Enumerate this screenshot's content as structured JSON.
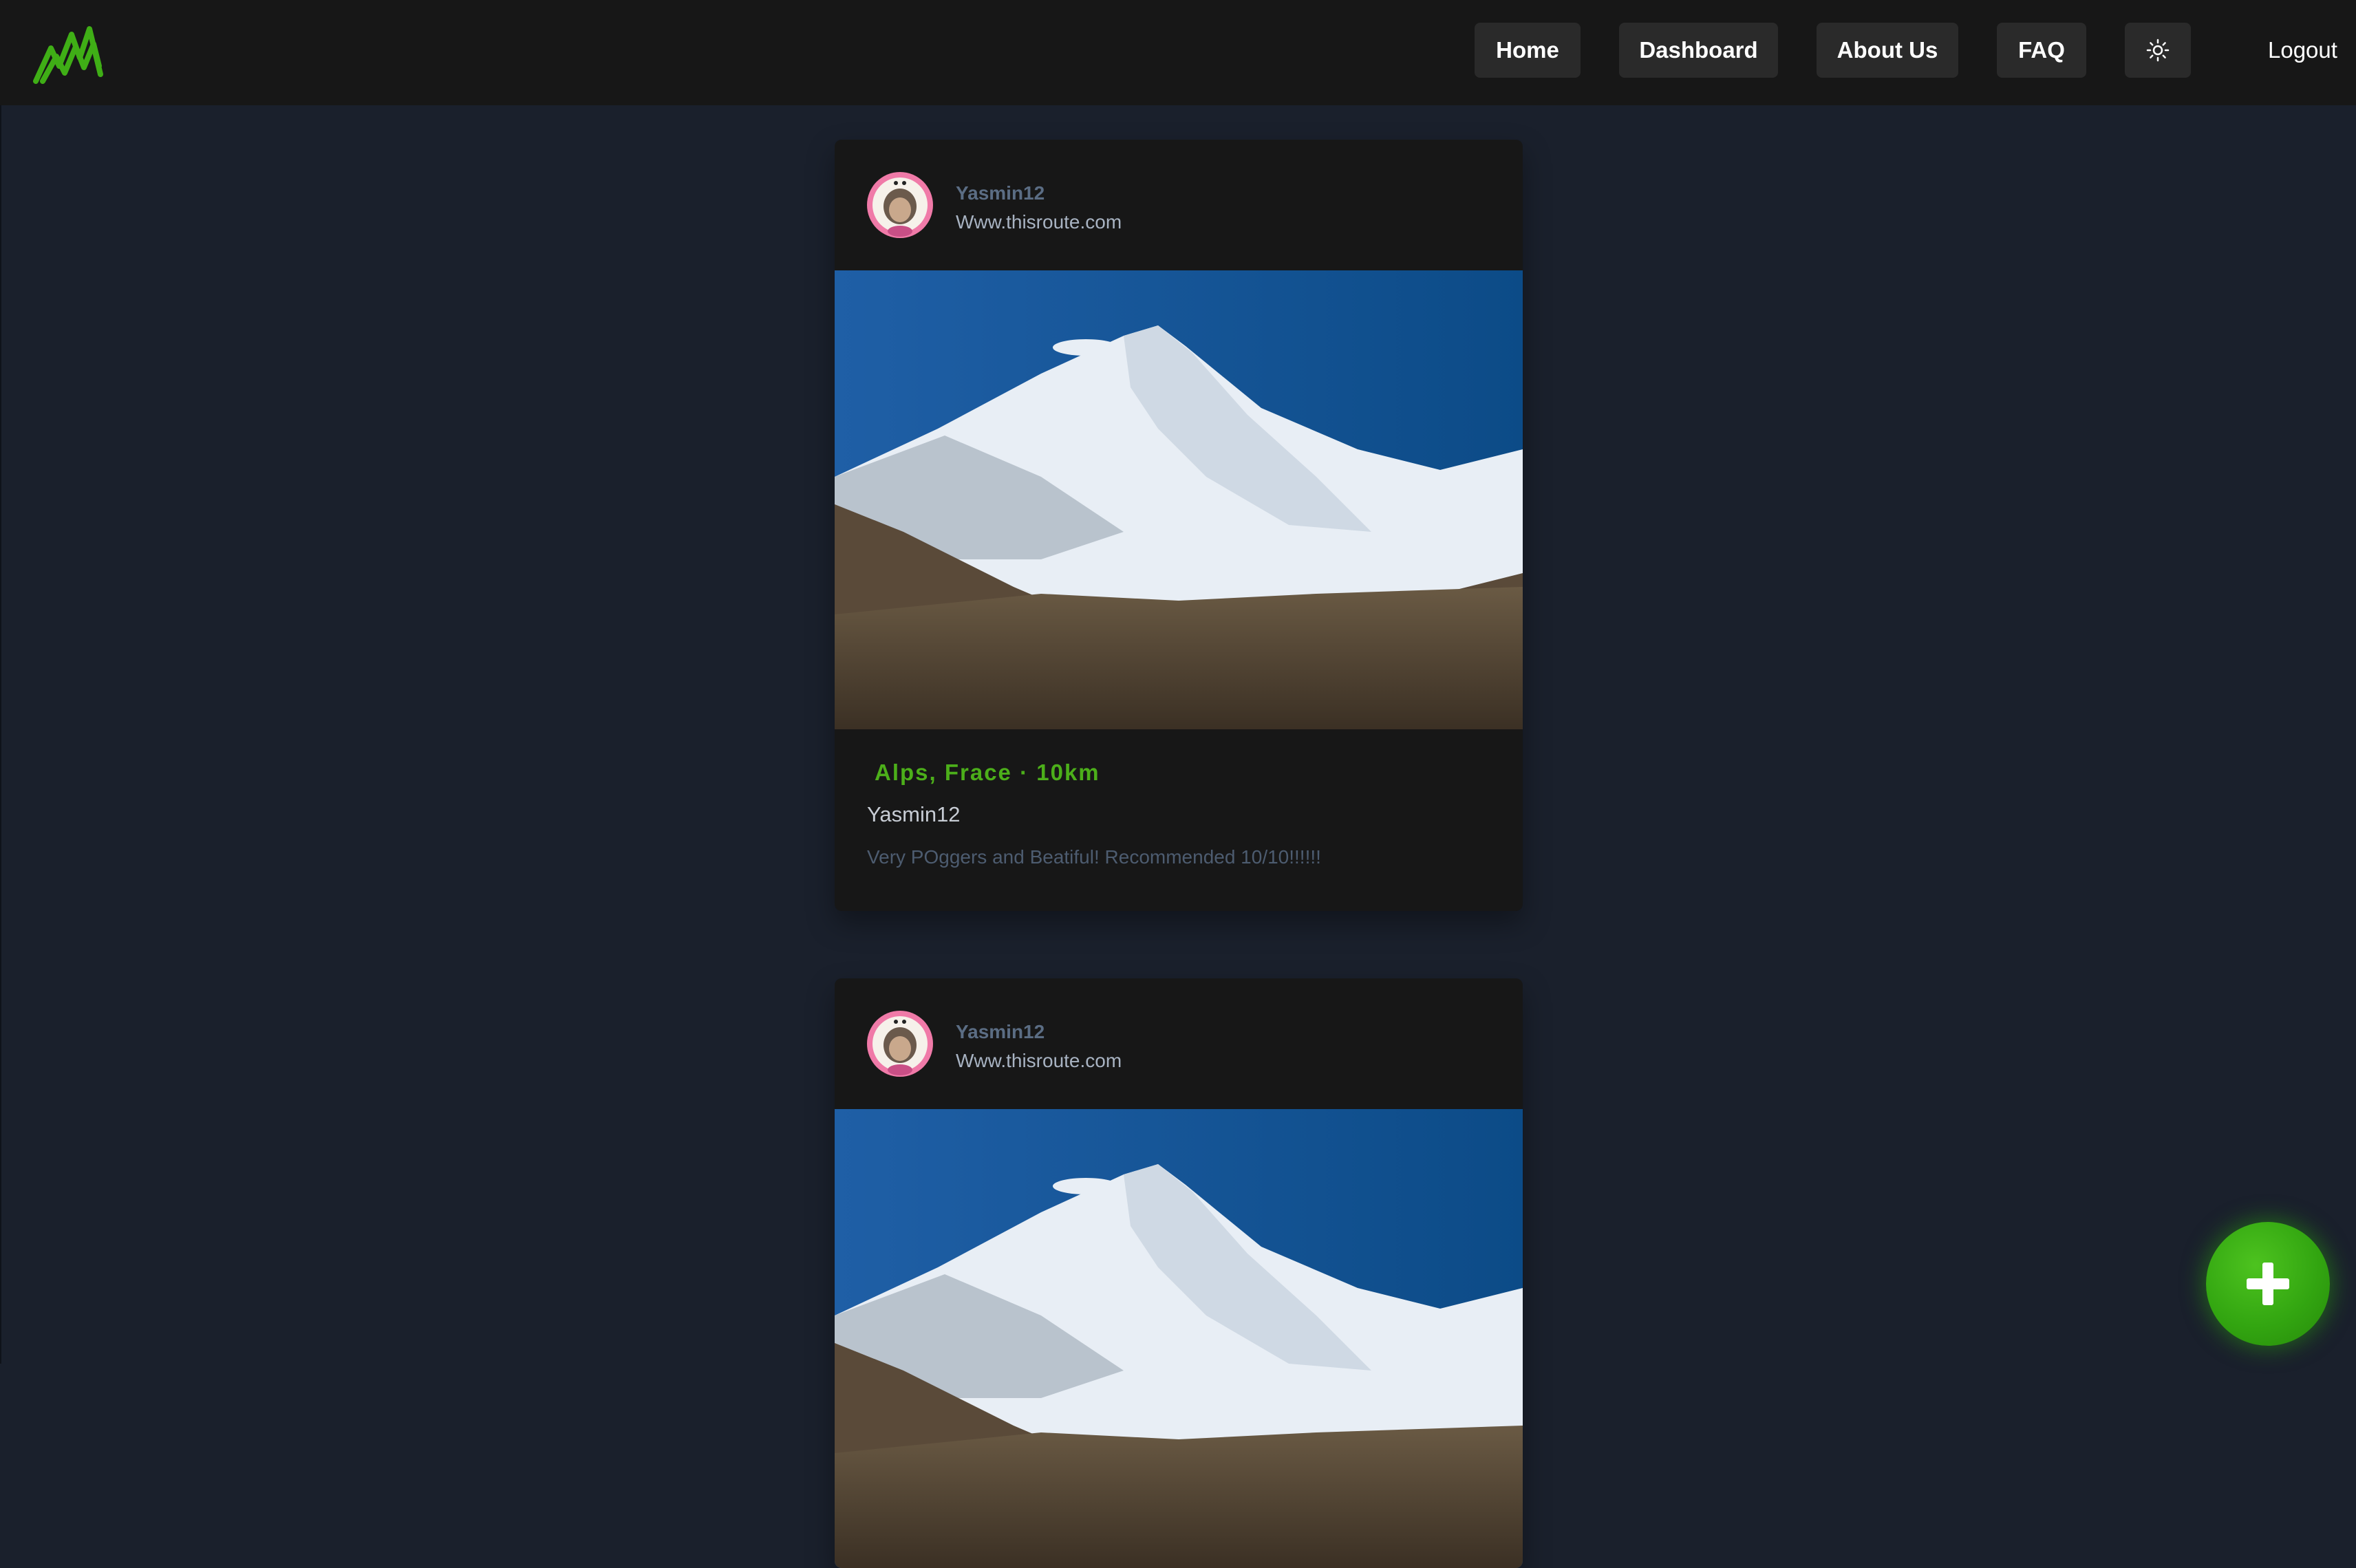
{
  "nav": {
    "logo_icon": "mountain-logo-icon",
    "home_label": "Home",
    "dashboard_label": "Dashboard",
    "about_label": "About Us",
    "faq_label": "FAQ",
    "theme_icon": "sun-icon",
    "logout_label": "Logout"
  },
  "colors": {
    "accent": "#4caf1a",
    "navbar_bg": "#171717",
    "page_bg": "#1a202c",
    "card_bg": "#171717"
  },
  "posts": [
    {
      "username": "Yasmin12",
      "website": "Www.thisroute.com",
      "location_line": "Alps, Frace · 10km",
      "author": "Yasmin12",
      "description": "Very POggers and Beatiful! Recommended 10/10!!!!!!"
    },
    {
      "username": "Yasmin12",
      "website": "Www.thisroute.com"
    }
  ],
  "fab": {
    "icon": "plus-icon"
  }
}
